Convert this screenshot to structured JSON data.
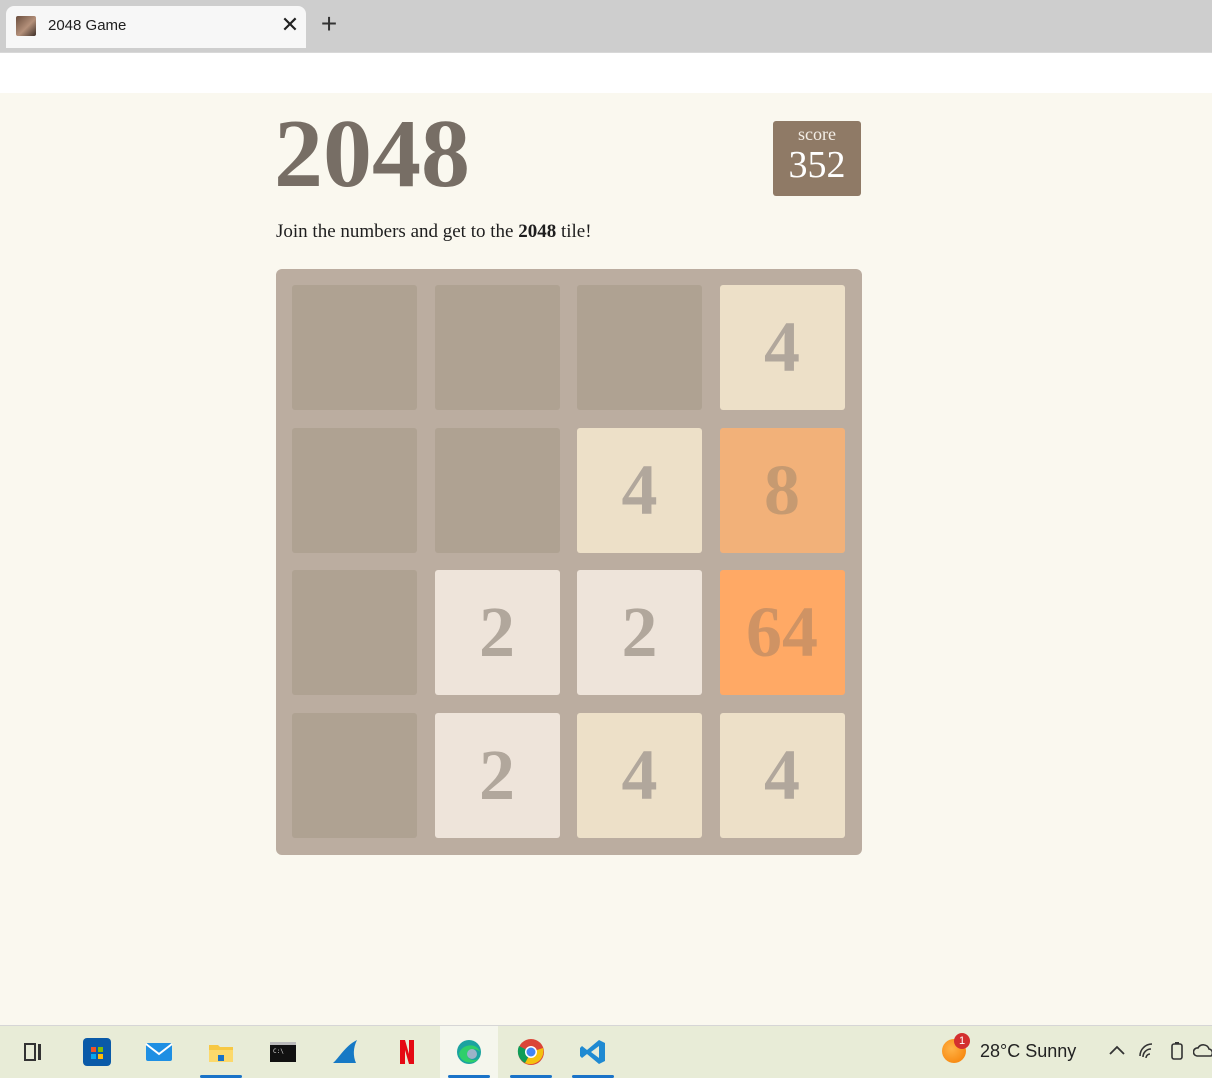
{
  "browser": {
    "tab_title": "2048 Game",
    "tab_close": "✕",
    "new_tab": "+"
  },
  "game": {
    "title": "2048",
    "score_label": "score",
    "score_value": "352",
    "intro_before": "Join the numbers and get to the ",
    "intro_bold": "2048",
    "intro_after": " tile!",
    "grid": [
      [
        "",
        "",
        "",
        "4"
      ],
      [
        "",
        "",
        "4",
        "8"
      ],
      [
        "",
        "2",
        "2",
        "64"
      ],
      [
        "",
        "2",
        "4",
        "4"
      ]
    ]
  },
  "taskbar": {
    "apps": [
      "task-view",
      "microsoft-store",
      "mail",
      "file-explorer",
      "terminal",
      "wireshark",
      "netflix",
      "edge",
      "chrome",
      "vscode"
    ],
    "weather_badge": "1",
    "weather_text": "28°C  Sunny"
  }
}
